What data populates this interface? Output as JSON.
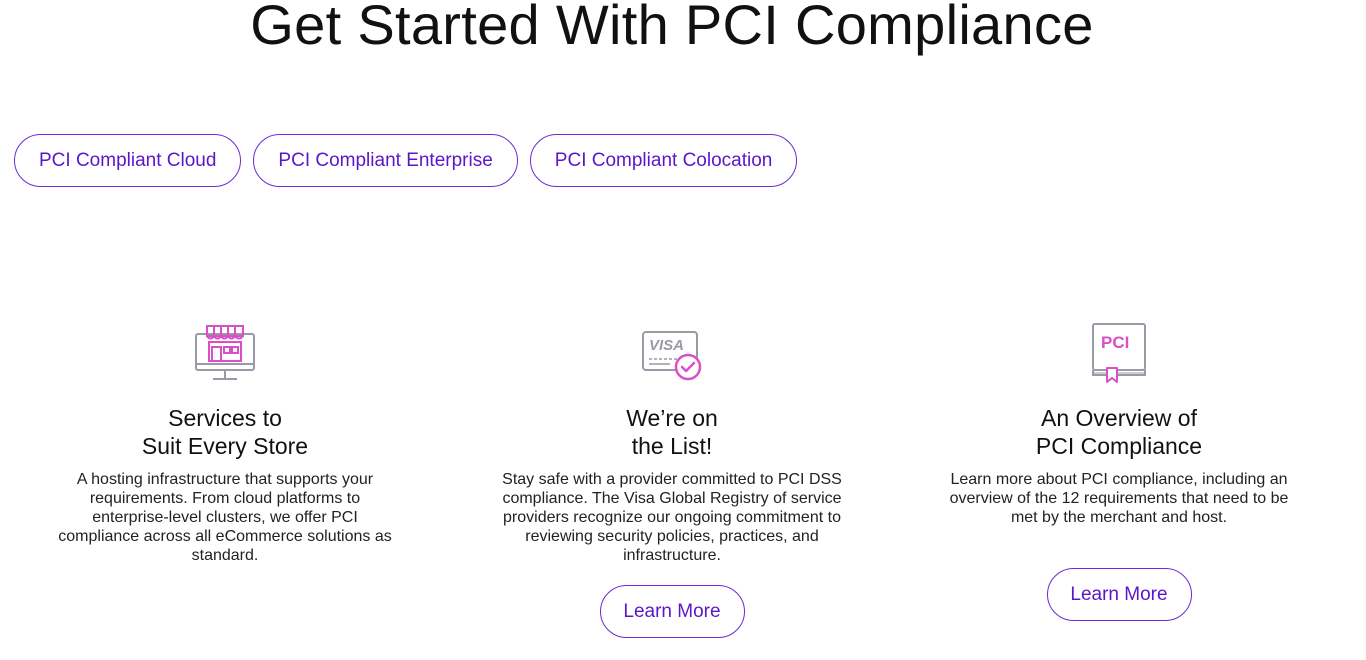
{
  "page_title": "Get Started With PCI Compliance",
  "tabs": [
    {
      "label": "PCI Compliant Cloud"
    },
    {
      "label": "PCI Compliant Enterprise"
    },
    {
      "label": "PCI Compliant Colocation"
    }
  ],
  "cards": [
    {
      "icon": "storefront-monitor-icon",
      "title_line1": "Services to",
      "title_line2": "Suit Every Store",
      "body": "A hosting infrastructure that supports your requirements. From cloud platforms to enterprise-level clusters, we offer PCI compliance across all eCommerce solutions as standard."
    },
    {
      "icon": "visa-card-check-icon",
      "icon_text": "VISA",
      "title_line1": "We’re on",
      "title_line2": "the List!",
      "body": "Stay safe with a provider committed to PCI DSS compliance. The Visa Global Registry of service providers recognize our ongoing commitment to reviewing security policies, practices, and infrastructure.",
      "button_label": "Learn More"
    },
    {
      "icon": "pci-book-icon",
      "icon_text": "PCI",
      "title_line1": "An Overview of",
      "title_line2": "PCI Compliance",
      "body": "Learn more about PCI compliance, including an overview of the 12 requirements that need to be met by the merchant and host.",
      "button_label": "Learn More"
    }
  ],
  "colors": {
    "accent": "#5a17c9",
    "icon_pink": "#d94fc8",
    "icon_gray": "#9a9aa6"
  }
}
